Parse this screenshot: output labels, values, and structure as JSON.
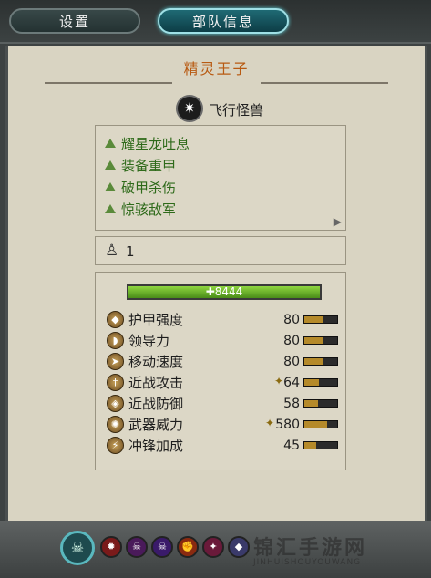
{
  "tabs": {
    "settings": "设置",
    "unit_info": "部队信息"
  },
  "unit": {
    "name": "精灵王子",
    "class": "飞行怪兽",
    "class_icon": "✷"
  },
  "abilities": [
    "耀星龙吐息",
    "装备重甲",
    "破甲杀伤",
    "惊骇敌军"
  ],
  "count": {
    "icon": "♙",
    "value": "1"
  },
  "health": {
    "value": "8444",
    "icon": "✚"
  },
  "stats": [
    {
      "label": "护甲强度",
      "value": "80",
      "fill": 0.55,
      "icon": "shield"
    },
    {
      "label": "领导力",
      "value": "80",
      "fill": 0.55,
      "icon": "horn"
    },
    {
      "label": "移动速度",
      "value": "80",
      "fill": 0.55,
      "icon": "boot"
    },
    {
      "label": "近战攻击",
      "value": "64",
      "fill": 0.45,
      "icon": "sword",
      "mod_icon": "✦"
    },
    {
      "label": "近战防御",
      "value": "58",
      "fill": 0.42,
      "icon": "shield-defense"
    },
    {
      "label": "武器威力",
      "value": "580",
      "fill": 0.7,
      "icon": "burst",
      "mod_icon": "✦"
    },
    {
      "label": "冲锋加成",
      "value": "45",
      "fill": 0.35,
      "icon": "charge"
    }
  ],
  "watermark": {
    "main": "锦汇手游网",
    "sub": "JINHUISHOUYOUWANG"
  }
}
